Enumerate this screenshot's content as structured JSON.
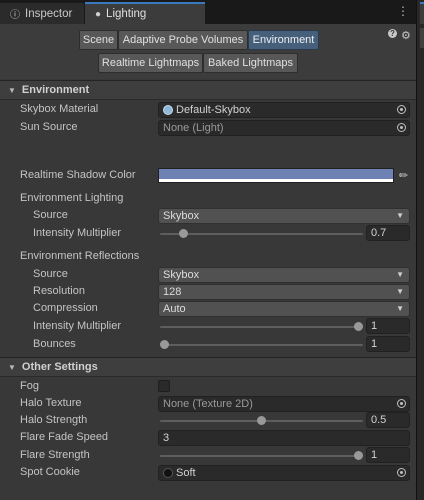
{
  "tabs": [
    {
      "label": "Inspector",
      "icon": "info-icon"
    },
    {
      "label": "Lighting",
      "icon": "lightbulb-icon"
    }
  ],
  "toolbar": {
    "row1": [
      "Scene",
      "Adaptive Probe Volumes",
      "Environment"
    ],
    "row2": [
      "Realtime Lightmaps",
      "Baked Lightmaps"
    ],
    "selected": "Environment"
  },
  "environment": {
    "title": "Environment",
    "skybox_material_label": "Skybox Material",
    "skybox_material_value": "Default-Skybox",
    "sun_source_label": "Sun Source",
    "sun_source_value": "None (Light)",
    "shadow_color_label": "Realtime Shadow Color",
    "shadow_color": "#6e82b4",
    "lighting": {
      "label": "Environment Lighting",
      "source_label": "Source",
      "source_value": "Skybox",
      "intensity_label": "Intensity Multiplier",
      "intensity_value": "0.7",
      "intensity_fraction": 0.1
    },
    "reflections": {
      "label": "Environment Reflections",
      "source_label": "Source",
      "source_value": "Skybox",
      "resolution_label": "Resolution",
      "resolution_value": "128",
      "compression_label": "Compression",
      "compression_value": "Auto",
      "intensity_label": "Intensity Multiplier",
      "intensity_value": "1",
      "intensity_fraction": 1.0,
      "bounces_label": "Bounces",
      "bounces_value": "1",
      "bounces_fraction": 0.0
    }
  },
  "other": {
    "title": "Other Settings",
    "fog_label": "Fog",
    "fog_checked": false,
    "halo_texture_label": "Halo Texture",
    "halo_texture_value": "None (Texture 2D)",
    "halo_strength_label": "Halo Strength",
    "halo_strength_value": "0.5",
    "halo_strength_fraction": 0.5,
    "flare_fade_label": "Flare Fade Speed",
    "flare_fade_value": "3",
    "flare_strength_label": "Flare Strength",
    "flare_strength_value": "1",
    "flare_strength_fraction": 1.0,
    "spot_cookie_label": "Spot Cookie",
    "spot_cookie_value": "Soft"
  },
  "colors": {
    "accent": "#3a79bb",
    "selected_button": "#46607c",
    "panel_bg": "#383838"
  }
}
